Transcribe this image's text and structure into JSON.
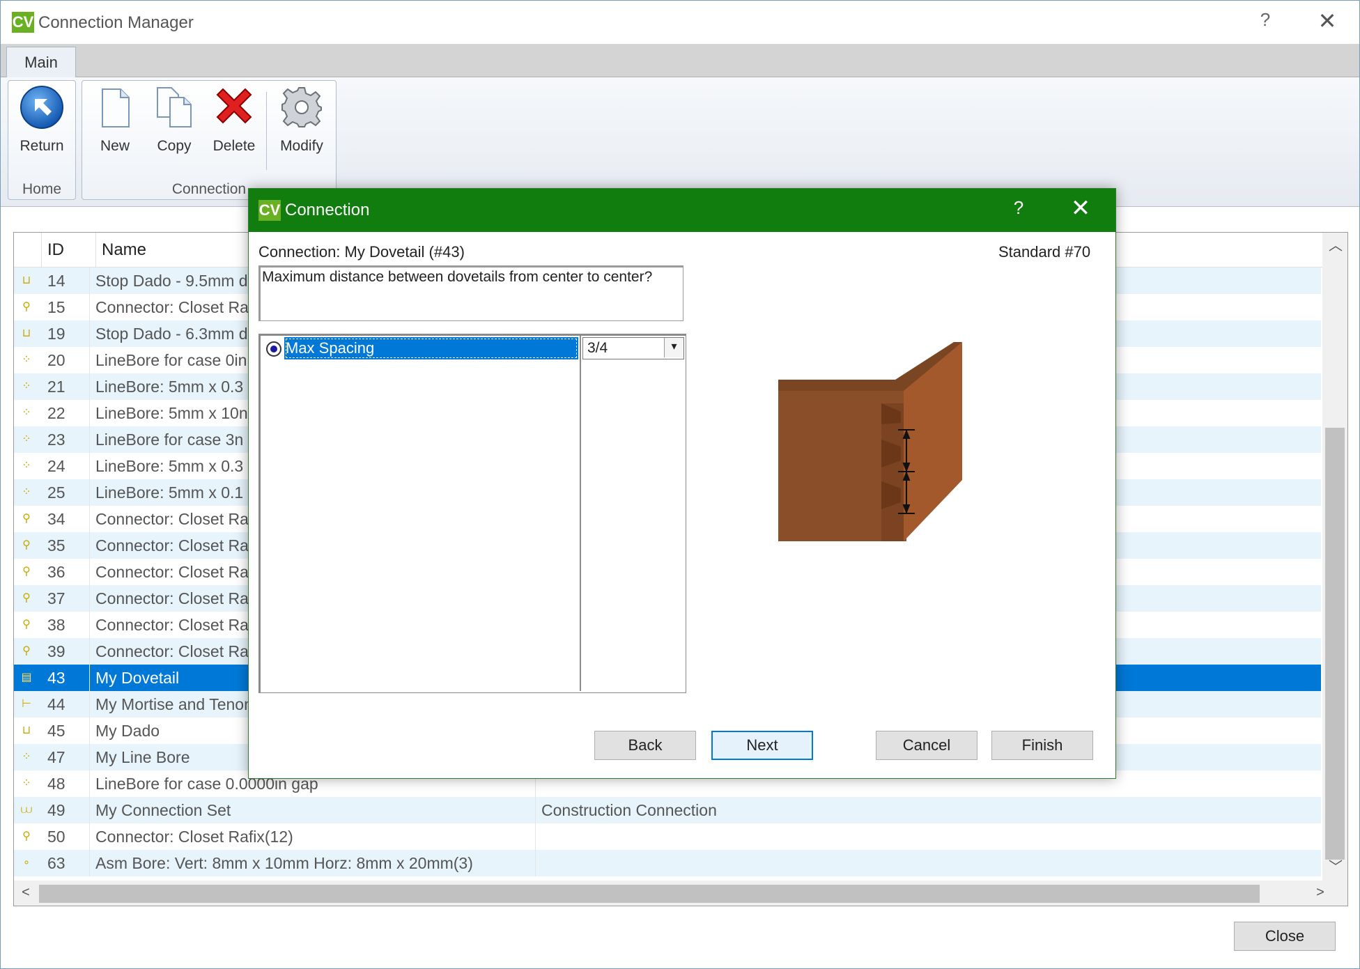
{
  "window": {
    "logo": "CV",
    "title": "Connection Manager",
    "help": "?",
    "close": "✕"
  },
  "ribbon": {
    "tabs": [
      {
        "label": "Main"
      }
    ],
    "groups": {
      "home": {
        "label": "Home",
        "buttons": [
          {
            "label": "Return",
            "icon": "return-arrow-icon"
          }
        ]
      },
      "connection": {
        "label": "Connection",
        "buttons": [
          {
            "label": "New",
            "icon": "new-document-icon"
          },
          {
            "label": "Copy",
            "icon": "copy-documents-icon"
          },
          {
            "label": "Delete",
            "icon": "delete-x-icon"
          },
          {
            "label": "Modify",
            "icon": "gear-icon"
          }
        ]
      }
    }
  },
  "list": {
    "columns": {
      "id": "ID",
      "name": "Name"
    },
    "rows": [
      {
        "icon": "dado-icon",
        "id": "14",
        "name": "Stop Dado - 9.5mm d",
        "type": ""
      },
      {
        "icon": "connector-icon",
        "id": "15",
        "name": "Connector: Closet Ra",
        "type": ""
      },
      {
        "icon": "dado-icon",
        "id": "19",
        "name": "Stop Dado - 6.3mm d",
        "type": ""
      },
      {
        "icon": "linebore-icon",
        "id": "20",
        "name": "LineBore for case 0in",
        "type": ""
      },
      {
        "icon": "linebore-icon",
        "id": "21",
        "name": "LineBore: 5mm x 0.3",
        "type": ""
      },
      {
        "icon": "linebore-icon",
        "id": "22",
        "name": "LineBore: 5mm x 10n",
        "type": ""
      },
      {
        "icon": "linebore-icon",
        "id": "23",
        "name": "LineBore for case 3n",
        "type": ""
      },
      {
        "icon": "linebore-icon",
        "id": "24",
        "name": "LineBore: 5mm x 0.3",
        "type": ""
      },
      {
        "icon": "linebore-icon",
        "id": "25",
        "name": "LineBore: 5mm x 0.1",
        "type": ""
      },
      {
        "icon": "connector-icon",
        "id": "34",
        "name": "Connector: Closet Ra",
        "type": ""
      },
      {
        "icon": "connector-icon",
        "id": "35",
        "name": "Connector: Closet Ra",
        "type": ""
      },
      {
        "icon": "connector-icon",
        "id": "36",
        "name": "Connector: Closet Ra",
        "type": ""
      },
      {
        "icon": "connector-icon",
        "id": "37",
        "name": "Connector: Closet Ra",
        "type": ""
      },
      {
        "icon": "connector-icon",
        "id": "38",
        "name": "Connector: Closet Ra",
        "type": ""
      },
      {
        "icon": "connector-icon",
        "id": "39",
        "name": "Connector: Closet Ra",
        "type": ""
      },
      {
        "icon": "dovetail-icon",
        "id": "43",
        "name": "My Dovetail",
        "type": "",
        "selected": true
      },
      {
        "icon": "mortise-tenon-icon",
        "id": "44",
        "name": "My Mortise and Tenon",
        "type": ""
      },
      {
        "icon": "dado-icon",
        "id": "45",
        "name": "My Dado",
        "type": ""
      },
      {
        "icon": "linebore-icon",
        "id": "47",
        "name": "My Line Bore",
        "type": ""
      },
      {
        "icon": "linebore-icon",
        "id": "48",
        "name": "LineBore for case 0.0000in gap",
        "type": ""
      },
      {
        "icon": "connection-set-icon",
        "id": "49",
        "name": "My Connection Set",
        "type": "Construction Connection"
      },
      {
        "icon": "connector-icon",
        "id": "50",
        "name": "Connector: Closet Rafix(12)",
        "type": ""
      },
      {
        "icon": "bore-icon",
        "id": "63",
        "name": "Asm Bore: Vert: 8mm x 10mm Horz: 8mm x 20mm(3)",
        "type": ""
      }
    ]
  },
  "footer": {
    "close_label": "Close"
  },
  "dialog": {
    "logo": "CV",
    "title": "Connection",
    "help": "?",
    "close": "✕",
    "connection_label": "Connection: My Dovetail (#43)",
    "standard_label": "Standard #70",
    "question": "Maximum distance between dovetails from center to center?",
    "parameter": {
      "label": "Max Spacing",
      "value": "3/4",
      "selected": true
    },
    "buttons": {
      "back": "Back",
      "next": "Next",
      "cancel": "Cancel",
      "finish": "Finish"
    }
  },
  "colors": {
    "dialog_title_bg": "#117d0f",
    "logo_bg": "#6ab023",
    "selection": "#0078d7",
    "row_alt": "#e7f4fb",
    "wood_front": "#8a4e28",
    "wood_side": "#a3592b",
    "wood_top": "#7a4522"
  }
}
